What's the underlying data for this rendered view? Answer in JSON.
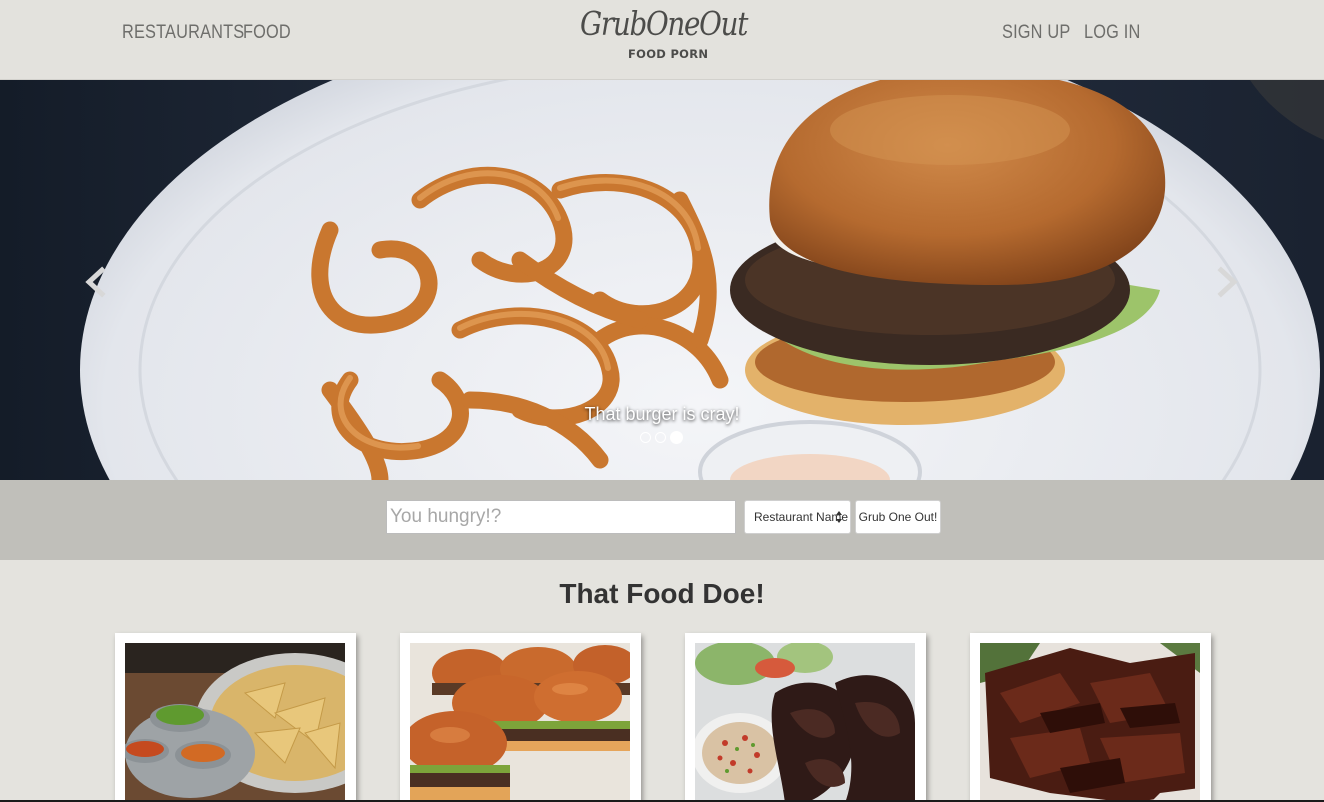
{
  "nav": {
    "left_links": [
      "RESTAURANTS",
      "FOOD"
    ],
    "right_links": [
      "SIGN UP",
      "LOG IN"
    ]
  },
  "logo": {
    "wordmark": "GrubOneOut",
    "tagline": "FOOD PORN"
  },
  "carousel": {
    "caption": "That burger is cray!",
    "slide_count": 3,
    "active_slide": 3,
    "prev_icon": "chevron-left-icon",
    "next_icon": "chevron-right-icon"
  },
  "search": {
    "placeholder": "You hungry!?",
    "value": "",
    "select_selected": "Restaurant Name",
    "submit_label": "Grub One Out!"
  },
  "food_section": {
    "title": "That Food Doe!",
    "cards": [
      {
        "image": "chips-and-salsa"
      },
      {
        "image": "burger-sliders"
      },
      {
        "image": "grilled-meat-with-salsa"
      },
      {
        "image": "beef-jerky"
      }
    ]
  },
  "colors": {
    "page_bg": "#e4e3de",
    "navbar_bg": "#e3e2dd",
    "nav_text": "#6e6e6b",
    "search_band_bg": "#c0bfba",
    "title_text": "#333333"
  }
}
